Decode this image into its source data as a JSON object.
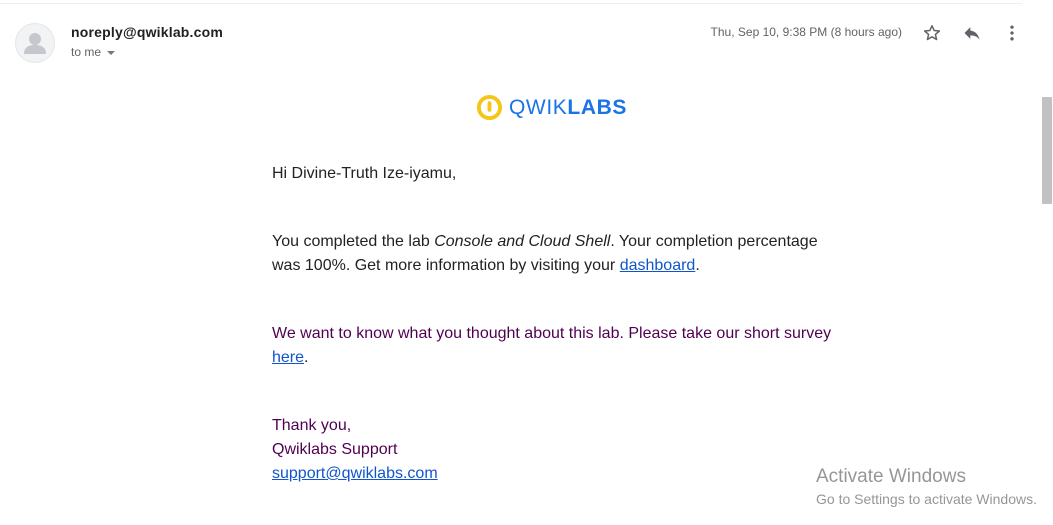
{
  "message": {
    "sender": "noreply@qwiklab.com",
    "recipient": "to me",
    "timestamp": "Thu, Sep 10, 9:38 PM (8 hours ago)",
    "actions": {
      "star_icon": "star-icon",
      "reply_icon": "reply-icon",
      "more_icon": "more-vert-icon"
    }
  },
  "brand": {
    "word_a": "QWIK",
    "word_b": "LABS",
    "colors": {
      "mark": "#f5c518",
      "text": "#1a73e8"
    }
  },
  "body": {
    "greeting": "Hi Divine-Truth Ize-iyamu,",
    "p1_before": "You completed the lab ",
    "p1_lab": "Console and Cloud Shell",
    "p1_after": ". Your completion percentage was 100%. Get more information by visiting your ",
    "p1_link": "dashboard",
    "p1_end": ".",
    "p2_before": "We want to know what you thought about this lab. Please take our short survey ",
    "p2_link": "here",
    "p2_end": ".",
    "thanks": "Thank you,",
    "team": "Qwiklabs Support",
    "support_email": "support@qwiklabs.com"
  },
  "overlay": {
    "title": "Activate Windows",
    "subtitle": "Go to Settings to activate Windows."
  },
  "colors": {
    "link": "#1155cc",
    "quoted_text": "#500050",
    "secondary_text": "#5f6368"
  }
}
